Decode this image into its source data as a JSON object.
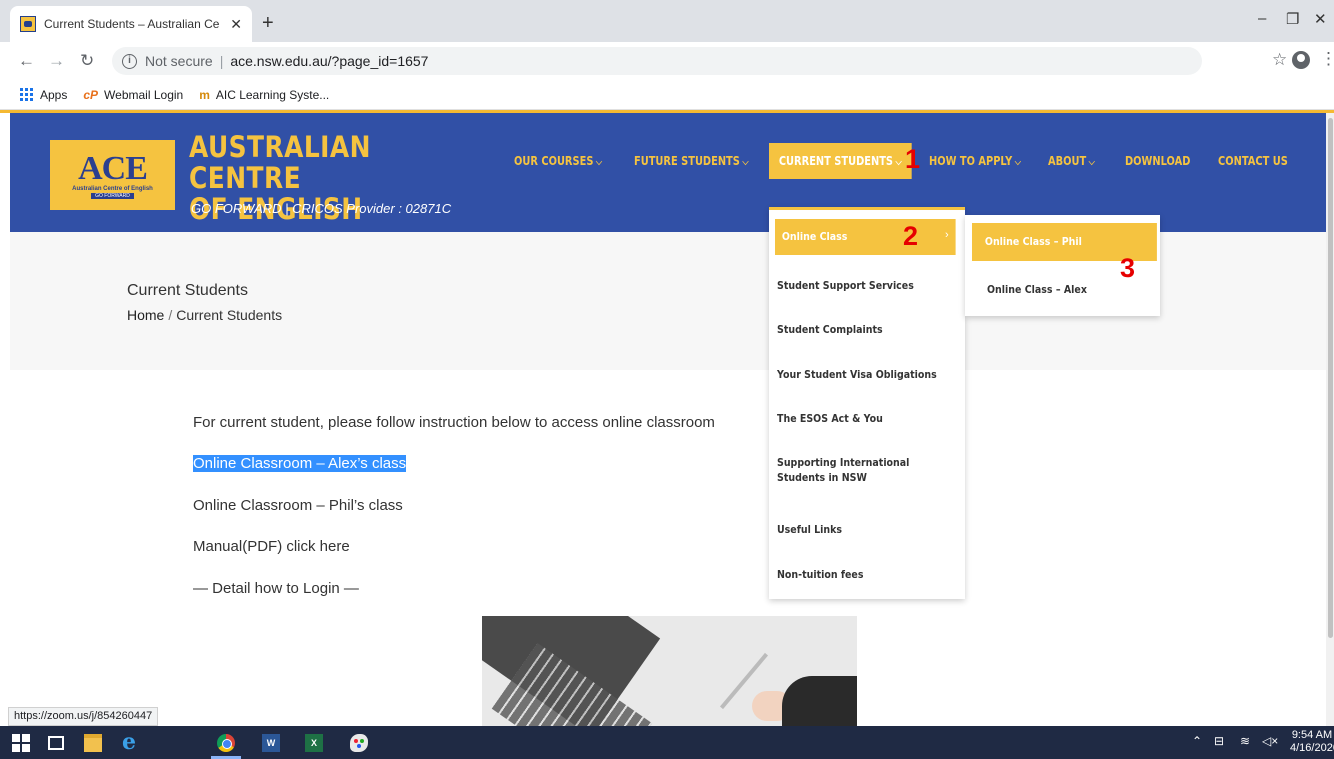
{
  "browser": {
    "tab_title": "Current Students – Australian Ce",
    "tab_close": "✕",
    "new_tab": "+",
    "not_secure": "Not secure",
    "url": "ace.nsw.edu.au/?page_id=1657",
    "window_controls": {
      "minimize": "–",
      "restore": "❐",
      "close": "✕"
    },
    "bookmarks": [
      "Apps",
      "Webmail Login",
      "AIC Learning Syste..."
    ],
    "status_url": "https://zoom.us/j/854260447"
  },
  "header": {
    "logo_letters": "ACE",
    "logo_sub": "Australian Centre of English",
    "logo_tag": "GO FORWARD",
    "site_title_line1": "AUSTRALIAN CENTRE",
    "site_title_line2": "OF ENGLISH",
    "tagline": "GO FORWARD | CRICOS Provider : 02871C",
    "brand_blue": "#3150a6",
    "brand_yellow": "#f5c340"
  },
  "nav": {
    "items": [
      {
        "label": "OUR COURSES",
        "has_dropdown": true
      },
      {
        "label": "FUTURE STUDENTS",
        "has_dropdown": true
      },
      {
        "label": "CURRENT STUDENTS",
        "has_dropdown": true,
        "active": true
      },
      {
        "label": "HOW TO APPLY",
        "has_dropdown": true
      },
      {
        "label": "ABOUT",
        "has_dropdown": true
      },
      {
        "label": "DOWNLOAD",
        "has_dropdown": false
      },
      {
        "label": "CONTACT US",
        "has_dropdown": false
      }
    ]
  },
  "dropdown": {
    "items": [
      "Online Class",
      "Student Support Services",
      "Student Complaints",
      "Your Student Visa Obligations",
      "The ESOS Act & You",
      "Supporting International",
      "Students in NSW",
      "Useful Links",
      "Non-tuition fees"
    ],
    "submenu": [
      "Online Class – Phil",
      "Online Class – Alex"
    ]
  },
  "markers": [
    "1",
    "2",
    "3"
  ],
  "page": {
    "title": "Current Students",
    "breadcrumb_home": "Home",
    "breadcrumb_sep": "/",
    "breadcrumb_current": "Current Students"
  },
  "content": {
    "intro": "For current student, please follow instruction below to access online classroom",
    "link_alex": "Online Classroom – Alex’s class",
    "link_phil": "Online Classroom – Phil’s class",
    "manual": "Manual(PDF) click here",
    "detail": "— Detail how to Login —"
  },
  "taskbar": {
    "time": "9:54 AM",
    "date": "4/16/2020",
    "word_label": "W",
    "excel_label": "X"
  }
}
